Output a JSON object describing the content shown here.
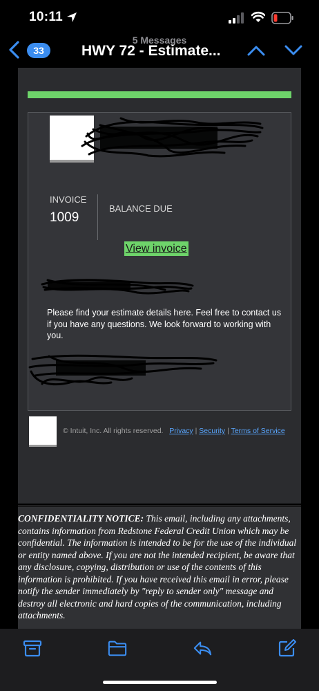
{
  "status_bar": {
    "time": "10:11",
    "icons": [
      "location-arrow-icon",
      "cellular-signal-icon",
      "wifi-icon",
      "battery-low-icon"
    ],
    "battery_color": "#ff3b30"
  },
  "nav": {
    "back_badge": "33",
    "message_count": "5 Messages",
    "title": "HWY 72 - Estimate...",
    "accent": "#3b8df0"
  },
  "email": {
    "invoice_label": "INVOICE",
    "invoice_number": "1009",
    "balance_label": "BALANCE DUE",
    "view_button": "View invoice",
    "button_color": "#6ed46a",
    "message": "Please find your estimate details here. Feel free to contact us if you have any questions. We look forward to working with you.",
    "footer": {
      "copyright": "© Intuit, Inc. All rights reserved.",
      "privacy": "Privacy",
      "security": "Security",
      "terms": "Terms of Service",
      "separator": "|"
    }
  },
  "confidentiality": {
    "heading": "CONFIDENTIALITY NOTICE:",
    "body": " This email, including any attachments, contains information from Redstone Federal Credit Union which may be confidential. The information is intended to be for the use of the individual or entity named above. If you are not the intended recipient, be aware that any disclosure, copying, distribution or use of the contents of this information is prohibited. If you have received this email in error, please notify the sender immediately by \"reply to sender only\" message and destroy all electronic and hard copies of the communication, including attachments."
  },
  "toolbar": {
    "icons": [
      "archive-icon",
      "folder-icon",
      "reply-icon",
      "compose-icon"
    ]
  }
}
